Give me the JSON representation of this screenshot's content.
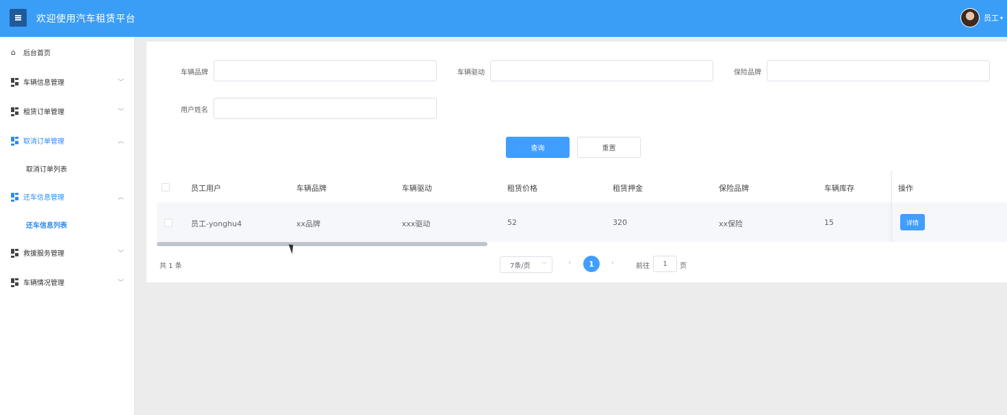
{
  "header": {
    "title": "欢迎使用汽车租赁平台",
    "user_name": "员工",
    "caret": "▾"
  },
  "sidebar": {
    "items": [
      {
        "label": "后台首页",
        "icon": "home-icon"
      },
      {
        "label": "车辆信息管理",
        "icon": "grid-icon",
        "chevron": "﹀"
      },
      {
        "label": "租赁订单管理",
        "icon": "grid-icon",
        "chevron": "﹀"
      },
      {
        "label": "取消订单管理",
        "icon": "grid-icon",
        "chevron": "︿"
      },
      {
        "label": "还车信息管理",
        "icon": "grid-icon",
        "chevron": "︿"
      },
      {
        "label": "救援服务管理",
        "icon": "grid-icon",
        "chevron": "﹀"
      },
      {
        "label": "车辆情况管理",
        "icon": "grid-icon",
        "chevron": "﹀"
      }
    ],
    "sub_items": [
      {
        "label": "取消订单列表"
      },
      {
        "label": "还车信息列表"
      }
    ],
    "active_color": "#2d8cf0"
  },
  "search_form": {
    "brand_label": "车辆品牌",
    "drive_label": "车辆驱动",
    "insurance_label": "保险品牌",
    "user_label": "用户姓名",
    "brand_value": "",
    "drive_value": "",
    "insurance_value": "",
    "user_value": "",
    "query_label": "查询",
    "reset_label": "重置"
  },
  "table": {
    "columns": [
      "员工用户",
      "车辆品牌",
      "车辆驱动",
      "租赁价格",
      "租赁押金",
      "保险品牌",
      "车辆库存",
      "操作"
    ],
    "rows": [
      {
        "user": "员工-yonghu4",
        "brand": "xx品牌",
        "drive": "xxx驱动",
        "price": "52",
        "deposit": "320",
        "insurance": "xx保险",
        "stock": "15",
        "action": "详情"
      }
    ]
  },
  "pagination": {
    "total_text": "共 1 条",
    "page_size": "7条/页",
    "prev": "‹",
    "next": "›",
    "current_page": "1",
    "goto_label": "前往",
    "goto_value": "1",
    "goto_suffix": "页"
  },
  "colors": {
    "header_bg": "#3a9ef7",
    "primary": "#409eff",
    "menu_button": "#1f5a9b"
  }
}
